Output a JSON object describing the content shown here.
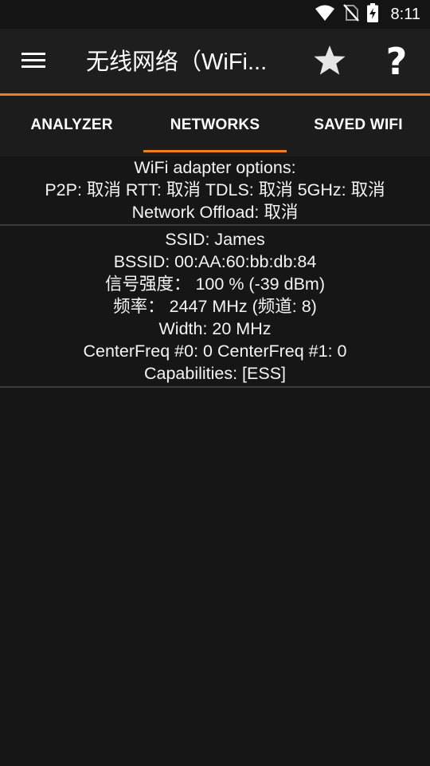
{
  "status_bar": {
    "time": "8:11",
    "icons": [
      "wifi-icon",
      "no-sim-icon",
      "battery-charging-icon"
    ]
  },
  "app_bar": {
    "title": "无线网络（WiFi...",
    "menu_icon": "menu-icon",
    "star_icon": "star-icon",
    "help_label": "?"
  },
  "tabs": [
    {
      "label": "ANALYZER",
      "selected": false
    },
    {
      "label": "NETWORKS",
      "selected": true
    },
    {
      "label": "SAVED WIFI",
      "selected": false
    }
  ],
  "adapter_options": {
    "title": "WiFi adapter options:",
    "line1": "P2P: 取消 RTT: 取消 TDLS: 取消 5GHz: 取消",
    "line2": "Network Offload: 取消"
  },
  "network": {
    "ssid": "SSID: James",
    "bssid": "BSSID: 00:AA:60:bb:db:84",
    "signal": "信号强度： 100 % (-39 dBm)",
    "frequency": "频率： 2447 MHz (频道: 8)",
    "width": "Width: 20 MHz",
    "center_freq": "CenterFreq #0: 0 CenterFreq #1: 0",
    "capabilities": "Capabilities: [ESS]"
  },
  "colors": {
    "accent": "#ee7e22",
    "background": "#161616",
    "app_bar": "#1e1e1e",
    "text": "#f4f4f4"
  }
}
